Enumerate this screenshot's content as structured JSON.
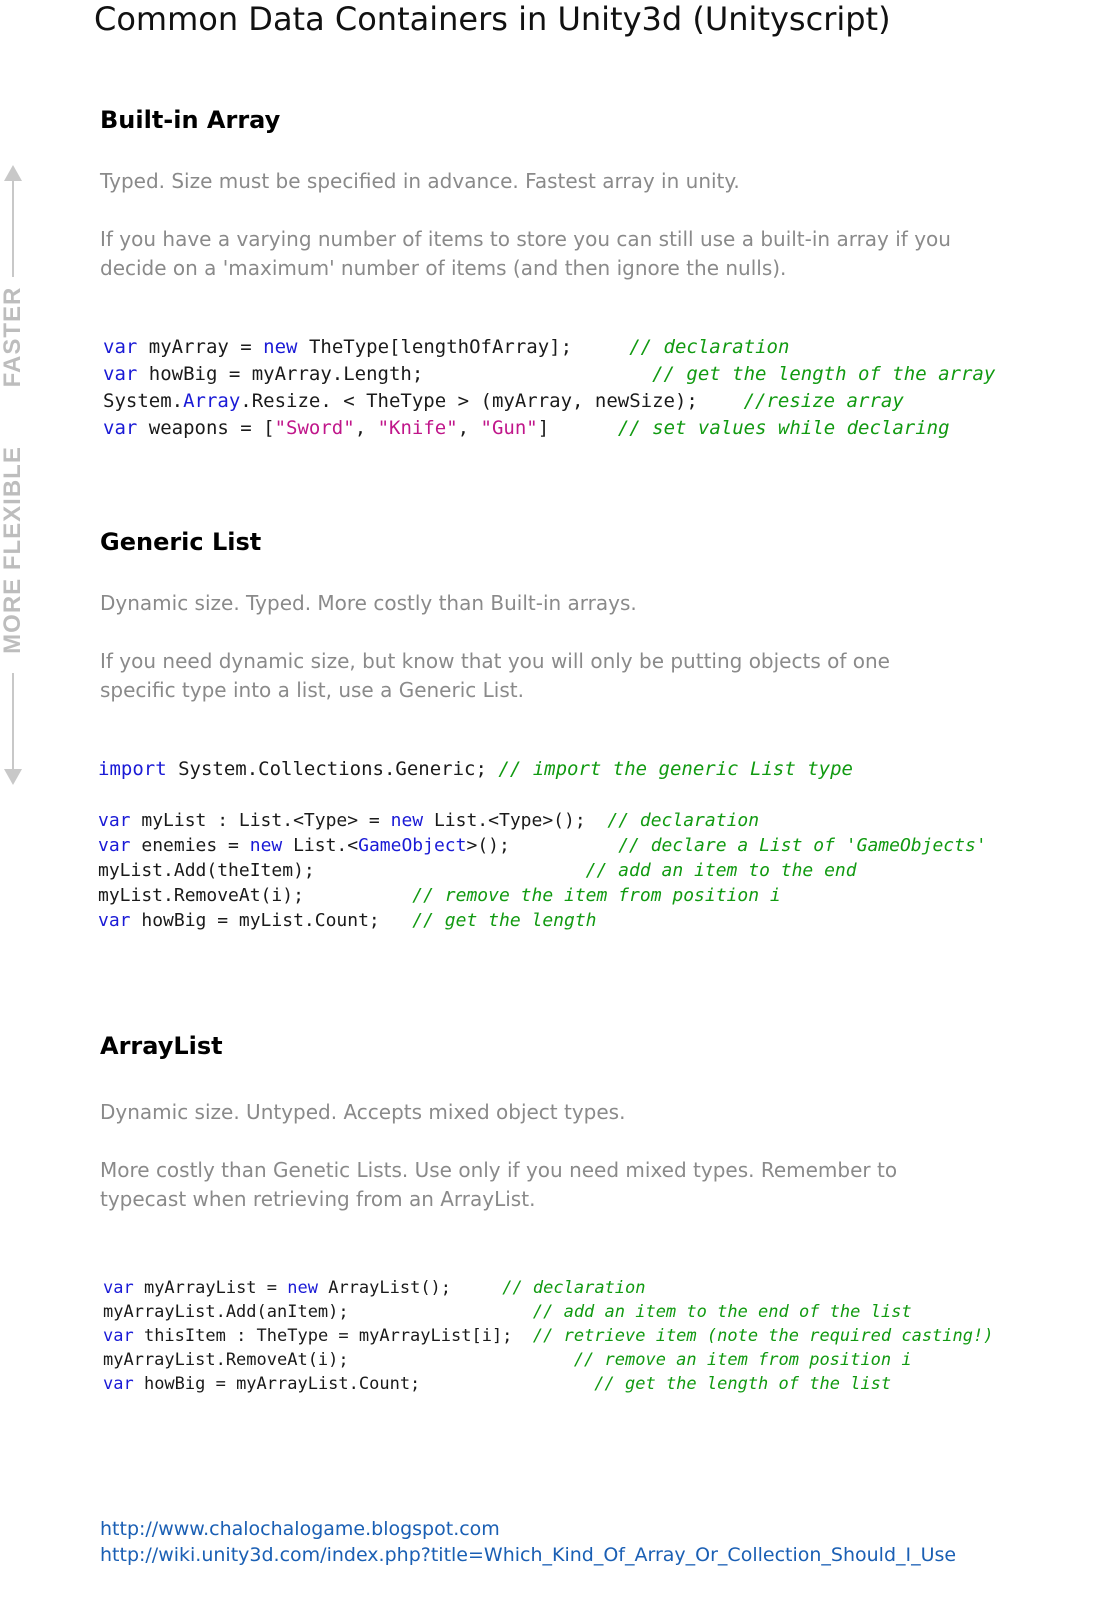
{
  "title": "Common Data Containers in Unity3d (Unityscript)",
  "side_labels": {
    "top": "FASTER",
    "bottom": "MORE FLEXIBLE"
  },
  "sections": [
    {
      "heading": "Built-in Array",
      "desc1": "Typed. Size must be specified in advance. Fastest array in unity.",
      "desc2": "If you have a varying number of items to store you can still use a built-in array if you decide on a 'maximum' number of items (and then ignore the nulls).",
      "code": [
        [
          [
            "kw",
            "var"
          ],
          [
            "p",
            " myArray = "
          ],
          [
            "kw",
            "new"
          ],
          [
            "p",
            " TheType[lengthOfArray];     "
          ],
          [
            "cm",
            "// declaration"
          ]
        ],
        [
          [
            "kw",
            "var"
          ],
          [
            "p",
            " howBig = myArray.Length;                    "
          ],
          [
            "cm",
            "// get the length of the array"
          ]
        ],
        [
          [
            "p",
            "System."
          ],
          [
            "kw",
            "Array"
          ],
          [
            "p",
            ".Resize. < TheType > (myArray, newSize);    "
          ],
          [
            "cm",
            "//resize array"
          ]
        ],
        [
          [
            "kw",
            "var"
          ],
          [
            "p",
            " weapons = ["
          ],
          [
            "str",
            "\"Sword\""
          ],
          [
            "p",
            ", "
          ],
          [
            "str",
            "\"Knife\""
          ],
          [
            "p",
            ", "
          ],
          [
            "str",
            "\"Gun\""
          ],
          [
            "p",
            "]      "
          ],
          [
            "cm",
            "// set values while declaring"
          ]
        ]
      ]
    },
    {
      "heading": "Generic List",
      "desc1": "Dynamic size. Typed. More costly than Built-in arrays.",
      "desc2": "If you need dynamic size, but know that you will only be putting objects of one specific type into a list, use a Generic List.",
      "import_line": [
        [
          "kw",
          "import"
        ],
        [
          "p",
          " System.Collections.Generic; "
        ],
        [
          "cm",
          "// import the generic List type"
        ]
      ],
      "code": [
        [
          [
            "kw",
            "var"
          ],
          [
            "p",
            " myList : List.<Type> = "
          ],
          [
            "kw",
            "new"
          ],
          [
            "p",
            " List.<Type>();  "
          ],
          [
            "cm",
            "// declaration"
          ]
        ],
        [
          [
            "kw",
            "var"
          ],
          [
            "p",
            " enemies = "
          ],
          [
            "kw",
            "new"
          ],
          [
            "p",
            " List.<"
          ],
          [
            "kw",
            "GameObject"
          ],
          [
            "p",
            ">();          "
          ],
          [
            "cm",
            "// declare a List of 'GameObjects'"
          ]
        ],
        [
          [
            "p",
            "myList.Add(theItem);                         "
          ],
          [
            "cm",
            "// add an item to the end"
          ]
        ],
        [
          [
            "p",
            "myList.RemoveAt(i);          "
          ],
          [
            "cm",
            "// remove the item from position i"
          ]
        ],
        [
          [
            "kw",
            "var"
          ],
          [
            "p",
            " howBig = myList.Count;   "
          ],
          [
            "cm",
            "// get the length"
          ]
        ]
      ]
    },
    {
      "heading": "ArrayList",
      "desc1": "Dynamic size. Untyped. Accepts mixed object types.",
      "desc2": "More costly than Genetic Lists. Use only if you need mixed types. Remember to typecast when retrieving from an ArrayList.",
      "code": [
        [
          [
            "kw",
            "var"
          ],
          [
            "p",
            " myArrayList = "
          ],
          [
            "kw",
            "new"
          ],
          [
            "p",
            " ArrayList();     "
          ],
          [
            "cm",
            "// declaration"
          ]
        ],
        [
          [
            "p",
            "myArrayList.Add(anItem);                  "
          ],
          [
            "cm",
            "// add an item to the end of the list"
          ]
        ],
        [
          [
            "kw",
            "var"
          ],
          [
            "p",
            " thisItem : TheType = myArrayList[i];  "
          ],
          [
            "cm",
            "// retrieve item (note the required casting!)"
          ]
        ],
        [
          [
            "p",
            "myArrayList.RemoveAt(i);                      "
          ],
          [
            "cm",
            "// remove an item from position i"
          ]
        ],
        [
          [
            "kw",
            "var"
          ],
          [
            "p",
            " howBig = myArrayList.Count;                 "
          ],
          [
            "cm",
            "// get the length of the list"
          ]
        ]
      ]
    }
  ],
  "links": [
    "http://www.chalochalogame.blogspot.com",
    "http://wiki.unity3d.com/index.php?title=Which_Kind_Of_Array_Or_Collection_Should_I_Use"
  ]
}
